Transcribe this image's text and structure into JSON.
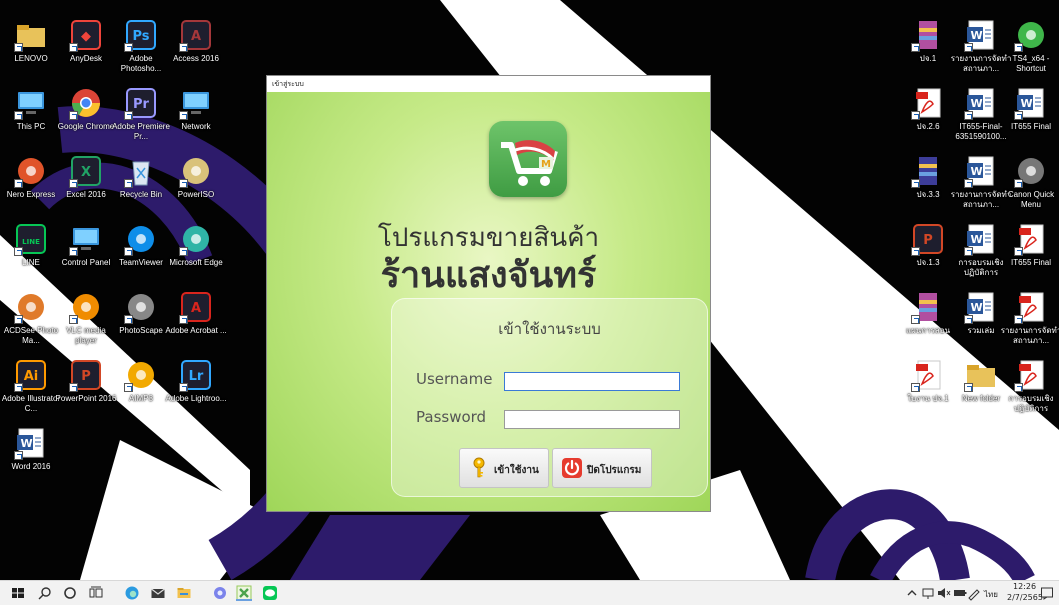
{
  "desktop": {
    "left_icons": [
      {
        "label": "LENOVO",
        "icon": "lenovo-folder-icon",
        "color": "#e8c25a"
      },
      {
        "label": "AnyDesk",
        "icon": "anydesk-icon",
        "color": "#ef443b"
      },
      {
        "label": "Adobe Photosho...",
        "icon": "photoshop-icon",
        "color": "#31a8ff"
      },
      {
        "label": "Access 2016",
        "icon": "access-icon",
        "color": "#a4373a"
      },
      {
        "label": "This PC",
        "icon": "this-pc-icon",
        "color": "#3a96dd"
      },
      {
        "label": "Google Chrome",
        "icon": "chrome-icon",
        "color": "#4caf50"
      },
      {
        "label": "Adobe Premiere Pr...",
        "icon": "premiere-icon",
        "color": "#9999ff"
      },
      {
        "label": "Network",
        "icon": "network-icon",
        "color": "#3a96dd"
      },
      {
        "label": "Nero Express",
        "icon": "nero-icon",
        "color": "#e0542a"
      },
      {
        "label": "Excel 2016",
        "icon": "excel-icon",
        "color": "#21a366"
      },
      {
        "label": "Recycle Bin",
        "icon": "recycle-bin-icon",
        "color": "#b0c8e0"
      },
      {
        "label": "PowerISO",
        "icon": "poweriso-icon",
        "color": "#d9c27a"
      },
      {
        "label": "LINE",
        "icon": "line-icon",
        "color": "#06c755"
      },
      {
        "label": "Control Panel",
        "icon": "control-panel-icon",
        "color": "#3a96dd"
      },
      {
        "label": "TeamViewer",
        "icon": "teamviewer-icon",
        "color": "#0e8ee9"
      },
      {
        "label": "Microsoft Edge",
        "icon": "edge-icon",
        "color": "#2fb4a6"
      },
      {
        "label": "ACDSee Photo Ma...",
        "icon": "acdsee-icon",
        "color": "#e07a2a"
      },
      {
        "label": "VLC media player",
        "icon": "vlc-icon",
        "color": "#f08c00"
      },
      {
        "label": "PhotoScape",
        "icon": "photoscape-icon",
        "color": "#888888"
      },
      {
        "label": "Adobe Acrobat ...",
        "icon": "acrobat-icon",
        "color": "#d9251d"
      },
      {
        "label": "Adobe Illustrator C...",
        "icon": "illustrator-icon",
        "color": "#ff9a00"
      },
      {
        "label": "PowerPoint 2016",
        "icon": "powerpoint-icon",
        "color": "#d24726"
      },
      {
        "label": "AIMP3",
        "icon": "aimp-icon",
        "color": "#f2a900"
      },
      {
        "label": "Adobe Lightroo...",
        "icon": "lightroom-icon",
        "color": "#31a8ff"
      },
      {
        "label": "Word 2016",
        "icon": "word-icon",
        "color": "#2b579a"
      }
    ],
    "right_icons": [
      {
        "label": "ปจ.1",
        "icon": "winrar-icon",
        "color": "#b14fa0"
      },
      {
        "label": "รายงานการจัดทำสถานภา...",
        "icon": "word-doc-icon",
        "color": "#2b579a"
      },
      {
        "label": "TS4_x64 - Shortcut",
        "icon": "sims-icon",
        "color": "#3fb64a"
      },
      {
        "label": "ปจ.2.6",
        "icon": "pdf-icon",
        "color": "#d9251d"
      },
      {
        "label": "IT655-Final-6351590100...",
        "icon": "word-doc-icon",
        "color": "#2b579a"
      },
      {
        "label": "IT655 Final",
        "icon": "word-doc-icon",
        "color": "#2b579a"
      },
      {
        "label": "ปจ.3.3",
        "icon": "winrar-icon",
        "color": "#3d3d99"
      },
      {
        "label": "รายงานการจัดทำสถานภา...",
        "icon": "word-doc-icon",
        "color": "#2b579a"
      },
      {
        "label": "Canon Quick Menu",
        "icon": "canon-icon",
        "color": "#777777"
      },
      {
        "label": "ปจ.1.3",
        "icon": "powerpoint-file-icon",
        "color": "#d24726"
      },
      {
        "label": "การอบรมเชิงปฏิบัติการ",
        "icon": "word-doc-icon",
        "color": "#2b579a"
      },
      {
        "label": "IT655 Final",
        "icon": "pdf-thumb-icon",
        "color": "#d9251d"
      },
      {
        "label": "แผนการสอน",
        "icon": "winrar-icon",
        "color": "#b14fa0"
      },
      {
        "label": "รวมเล่ม",
        "icon": "word-doc-icon",
        "color": "#2b579a"
      },
      {
        "label": "รายงานการจัดทำสถานภา...",
        "icon": "pdf-thumb-icon",
        "color": "#d9251d"
      },
      {
        "label": "ใบงาน ปจ.1",
        "icon": "pdf-icon",
        "color": "#d9251d"
      },
      {
        "label": "New folder",
        "icon": "folder-icon",
        "color": "#e8c25a"
      },
      {
        "label": "การอบรมเชิงปฏิบัติการ",
        "icon": "pdf-thumb-icon",
        "color": "#d9251d"
      }
    ]
  },
  "window": {
    "title": "เข้าสู่ระบบ",
    "program_name": "โปรแกรมขายสินค้า",
    "store_name": "ร้านแสงจันทร์",
    "panel_title": "เข้าใช้งานระบบ",
    "username_label": "Username",
    "password_label": "Password",
    "username_value": "",
    "password_value": "",
    "login_button": "เข้าใช้งาน",
    "exit_button": "ปิดโปรแกรม"
  },
  "taskbar": {
    "language": "ไทย",
    "time": "12:26",
    "date": "2/7/2565"
  },
  "colors": {
    "accent_green": "#9fd659",
    "logo_green": "#3f9c43"
  }
}
